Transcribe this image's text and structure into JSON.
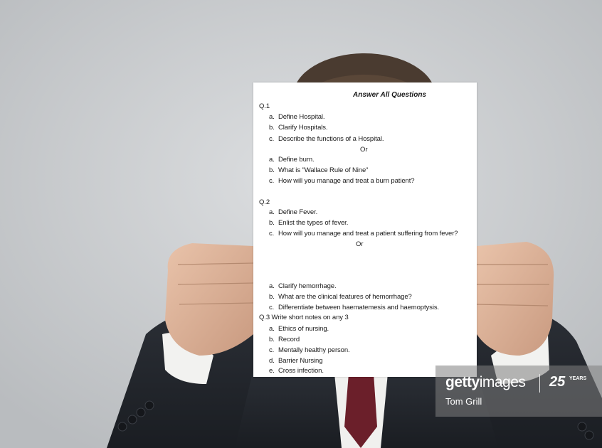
{
  "paper": {
    "title": "Answer All Questions",
    "q1": {
      "label": "Q.1",
      "items": [
        {
          "mark": "a.",
          "text": "Define Hospital."
        },
        {
          "mark": "b.",
          "text": "Clarify Hospitals."
        },
        {
          "mark": "c.",
          "text": "Describe the functions of a Hospital."
        }
      ],
      "or": "Or",
      "alt_items": [
        {
          "mark": "a.",
          "text": "Define burn."
        },
        {
          "mark": "b.",
          "text": "What is \"Wallace Rule of Nine\""
        },
        {
          "mark": "c.",
          "text": "How will you manage and treat a burn patient?"
        }
      ]
    },
    "q2": {
      "label": "Q.2",
      "items": [
        {
          "mark": "a.",
          "text": "Define Fever."
        },
        {
          "mark": "b.",
          "text": "Enlist the types of fever."
        },
        {
          "mark": "c.",
          "text": "How will you manage and treat a patient suffering from fever?"
        }
      ],
      "or": "Or",
      "alt_items": [
        {
          "mark": "a.",
          "text": "Clarify hemorrhage."
        },
        {
          "mark": "b.",
          "text": "What are the clinical features of hemorrhage?"
        },
        {
          "mark": "c.",
          "text": "Differentiate between haematemesis and haemoptysis."
        }
      ]
    },
    "q3": {
      "label": "Q.3 Write short notes on any 3",
      "items": [
        {
          "mark": "a.",
          "text": "Ethics of nursing."
        },
        {
          "mark": "b.",
          "text": "Record"
        },
        {
          "mark": "c.",
          "text": "Mentally healthy person."
        },
        {
          "mark": "d.",
          "text": "Barrier Nursing"
        },
        {
          "mark": "e.",
          "text": "Cross infection."
        }
      ]
    }
  },
  "watermark": {
    "brand_bold": "getty",
    "brand_light": "images",
    "years_number": "25",
    "years_label": "YEARS",
    "credit": "Tom Grill"
  }
}
